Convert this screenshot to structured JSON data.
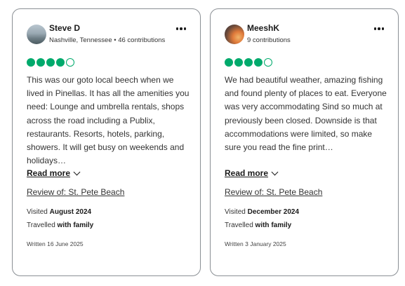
{
  "reviews": [
    {
      "user_name": "Steve D",
      "user_meta": "Nashville, Tennessee • 46 contributions",
      "rating": 4,
      "rating_max": 5,
      "text": "This was our goto local beech when we lived in Pinellas. It has all the amenities you need: Lounge and umbrella rentals, shops across the road including a Publix, restaurants. Resorts, hotels, parking, showers. It will get busy on weekends and holidays…",
      "read_more": "Read more",
      "review_of": "Review of: St. Pete Beach",
      "visited_label": "Visited",
      "visited_value": "August 2024",
      "travelled_label": "Travelled",
      "travelled_value": "with family",
      "written": "Written 16 June 2025"
    },
    {
      "user_name": "MeeshK",
      "user_meta": "9 contributions",
      "rating": 4,
      "rating_max": 5,
      "text": "We had beautiful weather, amazing fishing and found plenty of places to eat. Everyone was very accommodating Sind so much at previously been closed. Downside is that accommodations were limited, so make sure you read the fine print…",
      "read_more": "Read more",
      "review_of": "Review of: St. Pete Beach",
      "visited_label": "Visited",
      "visited_value": "December 2024",
      "travelled_label": "Travelled",
      "travelled_value": "with family",
      "written": "Written 3 January 2025"
    }
  ],
  "colors": {
    "rating_bubble": "#00aa6c",
    "card_border": "#8a8f94"
  },
  "icons": {
    "more": "more-options-icon",
    "chevron": "chevron-down-icon"
  }
}
